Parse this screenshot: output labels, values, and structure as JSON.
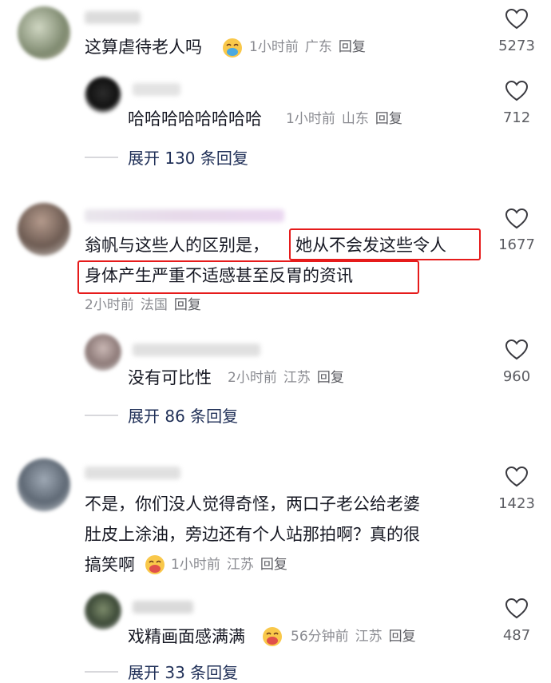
{
  "comments": [
    {
      "text": "这算虐待老人吗",
      "time": "1小时前",
      "loc": "广东",
      "reply": "回复",
      "likes": "5273"
    },
    {
      "text": "哈哈哈哈哈哈哈哈",
      "time": "1小时前",
      "loc": "山东",
      "reply": "回复",
      "likes": "712"
    },
    {
      "expand": "展开 130 条回复"
    },
    {
      "line1a": "翁帆与这些人的区别是，",
      "line1b": "她从不会发这些令人",
      "line2": "身体产生严重不适感甚至反胃的资讯",
      "time": "2小时前",
      "loc": "法国",
      "reply": "回复",
      "likes": "1677"
    },
    {
      "text": "没有可比性",
      "time": "2小时前",
      "loc": "江苏",
      "reply": "回复",
      "likes": "960"
    },
    {
      "expand": "展开 86 条回复"
    },
    {
      "line1": "不是，你们没人觉得奇怪，两口子老公给老婆",
      "line2": "肚皮上涂油，旁边还有个人站那拍啊？真的很",
      "line3": "搞笑啊",
      "time": "1小时前",
      "loc": "江苏",
      "reply": "回复",
      "likes": "1423"
    },
    {
      "text": "戏精画面感满满",
      "time": "56分钟前",
      "loc": "江苏",
      "reply": "回复",
      "likes": "487"
    },
    {
      "expand": "展开 33 条回复"
    }
  ],
  "icons": {
    "heart": "heart-outline-icon",
    "emoji": "crying-laughing-emoji-icon"
  },
  "colors": {
    "highlight_box": "#e61b1b",
    "meta": "#8a8b91",
    "expand": "#1f2f57"
  }
}
